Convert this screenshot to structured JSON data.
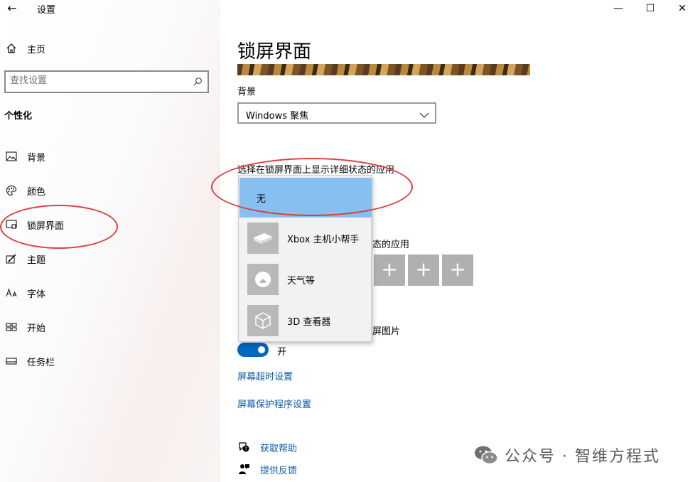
{
  "app": {
    "title": "设置",
    "back_glyph": "←"
  },
  "window_controls": {
    "minimize": "—",
    "maximize": "☐",
    "close": "✕"
  },
  "sidebar": {
    "home_label": "主页",
    "search_placeholder": "查找设置",
    "section_title": "个性化",
    "items": [
      {
        "label": "背景",
        "icon": "picture-icon"
      },
      {
        "label": "颜色",
        "icon": "palette-icon"
      },
      {
        "label": "锁屏界面",
        "icon": "lockscreen-icon"
      },
      {
        "label": "主题",
        "icon": "theme-icon"
      },
      {
        "label": "字体",
        "icon": "font-icon"
      },
      {
        "label": "开始",
        "icon": "start-icon"
      },
      {
        "label": "任务栏",
        "icon": "taskbar-icon"
      }
    ]
  },
  "main": {
    "title": "锁屏界面",
    "background_label": "背景",
    "background_value": "Windows 聚焦",
    "detailed_app_label": "选择在锁屏界面上显示详细状态的应用",
    "quick_status_label_tail": "态的应用",
    "signin_label_tail": "屏图片",
    "tile_glyph": "+",
    "toggle_label": "开",
    "toggle_on": true,
    "link_timeout": "屏幕超时设置",
    "link_screensaver": "屏幕保护程序设置",
    "help_get": "获取帮助",
    "help_feedback": "提供反馈"
  },
  "popup": {
    "items": [
      {
        "label": "无",
        "selected": true
      },
      {
        "label": "Xbox 主机小帮手",
        "icon": "xbox-icon"
      },
      {
        "label": "天气等",
        "icon": "weather-icon"
      },
      {
        "label": "3D 查看器",
        "icon": "cube-icon"
      }
    ]
  },
  "watermark": {
    "text": "公众号 · 智维方程式"
  },
  "colors": {
    "accent": "#0067c0",
    "selected": "#86bff0",
    "annotation": "#e03c3c",
    "link": "#0a5aa8"
  }
}
